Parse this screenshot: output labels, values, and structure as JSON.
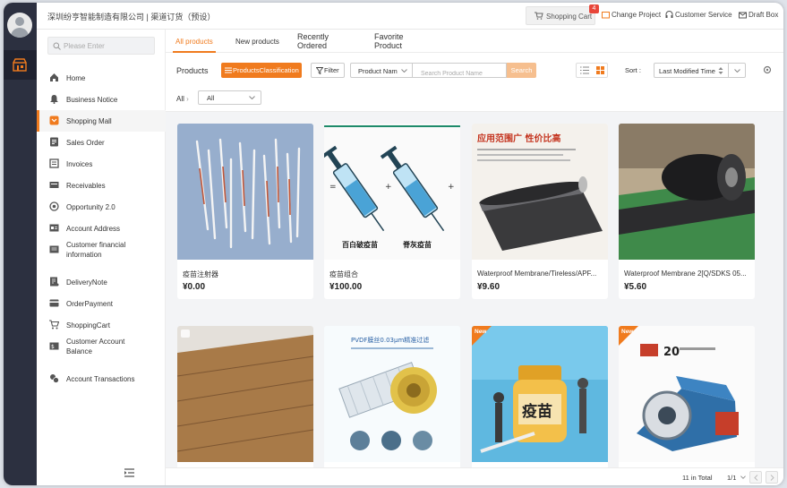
{
  "header": {
    "company": "深圳纷亨智能制造有限公司 | 渠道订货（预设）",
    "cart_label": "Shopping Cart",
    "cart_count": "4",
    "change_project": "Change Project",
    "customer_service": "Customer Service",
    "draft_box": "Draft Box"
  },
  "menu": {
    "search_placeholder": "Please Enter",
    "items": [
      {
        "label": "Home",
        "icon": "home-icon"
      },
      {
        "label": "Business Notice",
        "icon": "bell-icon"
      },
      {
        "label": "Shopping Mall",
        "icon": "mall-icon",
        "active": true
      },
      {
        "label": "Sales Order",
        "icon": "order-icon"
      },
      {
        "label": "Invoices",
        "icon": "invoice-icon"
      },
      {
        "label": "Receivables",
        "icon": "receivables-icon"
      },
      {
        "label": "Opportunity 2.0",
        "icon": "target-icon"
      },
      {
        "label": "Account Address",
        "icon": "address-icon"
      },
      {
        "label": "Customer financial information",
        "icon": "finance-icon"
      },
      {
        "label": "DeliveryNote",
        "icon": "delivery-icon"
      },
      {
        "label": "OrderPayment",
        "icon": "payment-icon"
      },
      {
        "label": "ShoppingCart",
        "icon": "cart-icon"
      },
      {
        "label": "Customer Account Balance",
        "icon": "balance-icon"
      },
      {
        "label": "Account Transactions",
        "icon": "transactions-icon"
      }
    ]
  },
  "tabs": [
    {
      "label": "All products",
      "active": true
    },
    {
      "label": "New products"
    },
    {
      "label": "Recently Ordered"
    },
    {
      "label": "Favorite Product"
    }
  ],
  "filters": {
    "products_label": "Products",
    "classification_label": "ProductsClassification",
    "filter_label": "Filter",
    "field_select": "Product Nam",
    "search_placeholder": "Search Product Name",
    "search_button": "Search",
    "sort_label": "Sort :",
    "sort_value": "Last Modified Time",
    "breadcrumb": "All",
    "category_select": "All"
  },
  "products": [
    {
      "name": "疫苗注射器",
      "price": "¥0.00",
      "image": "syringes-photo"
    },
    {
      "name": "疫苗组合",
      "price": "¥100.00",
      "image": "vaccine-illustration",
      "caption_left": "百白破疫苗",
      "caption_right": "脊灰疫苗"
    },
    {
      "name": "Waterproof Membrane/Tireless/APF...",
      "price": "¥9.60",
      "image": "membrane-roll-photo",
      "headline": "应用范围广 性价比高"
    },
    {
      "name": "Waterproof Membrane 2[Q/SDKS 05...",
      "price": "¥5.60",
      "image": "membrane-rolls-photo"
    },
    {
      "name": "",
      "price": "",
      "image": "wood-floor-photo"
    },
    {
      "name": "",
      "price": "",
      "image": "filter-cartridge-photo",
      "ribbon": "",
      "headline": "PVDF膜丝0.03μm精准过滤"
    },
    {
      "name": "",
      "price": "",
      "image": "vaccine-bottle-photo",
      "ribbon": "New",
      "label": "疫苗"
    },
    {
      "name": "",
      "price": "",
      "image": "machine-photo",
      "ribbon": "New",
      "badge": "20"
    }
  ],
  "footer": {
    "total": "11 in Total",
    "page": "1/1"
  },
  "colors": {
    "accent": "#f07b1e",
    "rail": "#2c3040",
    "badge": "#e8463a"
  }
}
